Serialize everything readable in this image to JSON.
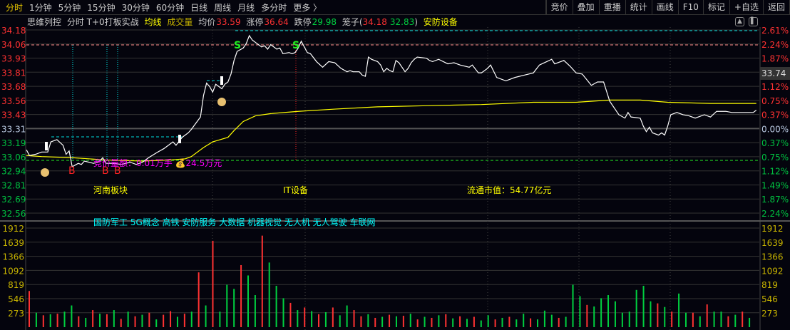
{
  "tabs": [
    "分时",
    "1分钟",
    "5分钟",
    "15分钟",
    "30分钟",
    "60分钟",
    "日线",
    "周线",
    "月线",
    "多分时",
    "更多 〉"
  ],
  "tools": [
    "竞价",
    "叠加",
    "重播",
    "统计",
    "画线",
    "F10",
    "标记",
    "+自选",
    "返回"
  ],
  "info": {
    "name": "思维列控",
    "mode": "分时 T+0打板实战",
    "avg_line": "均线",
    "volume": "成交量",
    "avg_label": "均价",
    "avg_value": "33.59",
    "limit_up_label": "涨停",
    "limit_up": "36.64",
    "limit_down_label": "跌停",
    "limit_down": "29.98",
    "cage_label": "笼子(",
    "cage_high": "34.18",
    "cage_low": "32.83",
    "cage_close": ")",
    "sector": "安防设备"
  },
  "annotations": {
    "auction": "竞价量额：0.01万手 ",
    "auction_amount": "24.5万元",
    "region": "河南板块",
    "industry": "IT设备",
    "market_cap": "流通市值：54.77亿元",
    "concepts": "国防军工 5G概念 高铁 安防服务 大数据 机器视觉 无人机 无人驾驶 车联网",
    "current_price": "33.74",
    "buy_mark": "B",
    "sell_mark": "S"
  },
  "colors": {
    "up": "#ff3232",
    "down": "#00d040",
    "price": "#ffffff",
    "avg": "#ffff00",
    "cyan": "#00e0e0"
  },
  "chart_data": {
    "type": "line",
    "price_axis": [
      "34.18",
      "34.06",
      "33.93",
      "33.81",
      "33.68",
      "33.56",
      "33.43",
      "33.31",
      "33.19",
      "33.06",
      "32.94",
      "32.81",
      "32.69",
      "32.56"
    ],
    "pct_axis": [
      "2.61%",
      "2.24%",
      "1.87%",
      "1.49%",
      "1.12%",
      "0.75%",
      "0.37%",
      "0.00%",
      "0.37%",
      "0.75%",
      "1.12%",
      "1.49%",
      "1.87%",
      "2.24%"
    ],
    "volume_axis": [
      "1912",
      "1639",
      "1366",
      "1092",
      "819",
      "546",
      "273"
    ],
    "ylim": [
      32.56,
      34.18
    ],
    "prev_close": 33.31,
    "price": [
      [
        0,
        33.12
      ],
      [
        1,
        33.07
      ],
      [
        3,
        33.08
      ],
      [
        5,
        33.1
      ],
      [
        7,
        33.1
      ],
      [
        8,
        33.19
      ],
      [
        10,
        33.21
      ],
      [
        12,
        33.16
      ],
      [
        13,
        33.08
      ],
      [
        14,
        33.11
      ],
      [
        15,
        32.97
      ],
      [
        17,
        33.0
      ],
      [
        18,
        32.99
      ],
      [
        19,
        33.02
      ],
      [
        22,
        33.0
      ],
      [
        24,
        33.02
      ],
      [
        25,
        33.05
      ],
      [
        26,
        33.0
      ],
      [
        29,
        33.0
      ],
      [
        31,
        32.99
      ],
      [
        34,
        33.01
      ],
      [
        36,
        32.99
      ],
      [
        38,
        33.01
      ],
      [
        40,
        33.05
      ],
      [
        43,
        33.1
      ],
      [
        45,
        33.13
      ],
      [
        47,
        33.17
      ],
      [
        48,
        33.19
      ],
      [
        49,
        33.16
      ],
      [
        51,
        33.23
      ],
      [
        53,
        33.27
      ],
      [
        54,
        33.3
      ],
      [
        57,
        33.41
      ],
      [
        58,
        33.6
      ],
      [
        59,
        33.71
      ],
      [
        60,
        33.68
      ],
      [
        61,
        33.63
      ],
      [
        62,
        33.7
      ],
      [
        64,
        33.66
      ],
      [
        65,
        33.7
      ],
      [
        66,
        33.72
      ],
      [
        67,
        33.79
      ],
      [
        68,
        33.91
      ],
      [
        69,
        33.99
      ],
      [
        71,
        34.02
      ],
      [
        72,
        34.06
      ],
      [
        73,
        34.13
      ],
      [
        74,
        34.09
      ],
      [
        75,
        34.07
      ],
      [
        77,
        34.03
      ],
      [
        78,
        34.04
      ],
      [
        79,
        34.01
      ],
      [
        80,
        34.05
      ],
      [
        82,
        34.01
      ],
      [
        83,
        34.02
      ],
      [
        84,
        33.97
      ],
      [
        86,
        33.98
      ],
      [
        87,
        33.97
      ],
      [
        88,
        33.98
      ],
      [
        89,
        34.02
      ],
      [
        90,
        34.08
      ],
      [
        92,
        33.98
      ],
      [
        93,
        33.97
      ],
      [
        95,
        33.9
      ],
      [
        97,
        33.85
      ],
      [
        99,
        33.9
      ],
      [
        101,
        33.89
      ],
      [
        103,
        33.84
      ],
      [
        105,
        33.81
      ],
      [
        106,
        33.82
      ],
      [
        107,
        33.81
      ],
      [
        109,
        33.81
      ],
      [
        110,
        33.78
      ],
      [
        111,
        33.77
      ],
      [
        112,
        33.94
      ],
      [
        113,
        33.92
      ],
      [
        115,
        33.9
      ],
      [
        116,
        33.87
      ],
      [
        117,
        33.81
      ],
      [
        118,
        33.84
      ],
      [
        119,
        33.82
      ],
      [
        120,
        33.81
      ],
      [
        121,
        33.91
      ],
      [
        122,
        33.89
      ],
      [
        124,
        33.81
      ],
      [
        125,
        33.84
      ],
      [
        126,
        33.89
      ],
      [
        127,
        33.92
      ],
      [
        128,
        33.94
      ],
      [
        131,
        33.93
      ],
      [
        132,
        33.91
      ],
      [
        133,
        33.9
      ],
      [
        135,
        33.92
      ],
      [
        138,
        33.88
      ],
      [
        140,
        33.89
      ],
      [
        142,
        33.87
      ],
      [
        145,
        33.85
      ],
      [
        146,
        33.87
      ],
      [
        148,
        33.8
      ],
      [
        149,
        33.8
      ],
      [
        151,
        33.84
      ],
      [
        152,
        33.87
      ],
      [
        154,
        33.76
      ],
      [
        157,
        33.73
      ],
      [
        160,
        33.76
      ],
      [
        163,
        33.78
      ],
      [
        166,
        33.8
      ],
      [
        168,
        33.87
      ],
      [
        172,
        33.92
      ],
      [
        173,
        33.88
      ],
      [
        176,
        33.91
      ],
      [
        178,
        33.86
      ],
      [
        180,
        33.8
      ],
      [
        182,
        33.79
      ],
      [
        185,
        33.69
      ],
      [
        187,
        33.72
      ],
      [
        189,
        33.72
      ],
      [
        191,
        33.55
      ],
      [
        194,
        33.43
      ],
      [
        196,
        33.4
      ],
      [
        197,
        33.45
      ],
      [
        198,
        33.41
      ],
      [
        201,
        33.4
      ],
      [
        202,
        33.33
      ],
      [
        203,
        33.28
      ],
      [
        204,
        33.32
      ],
      [
        205,
        33.27
      ],
      [
        207,
        33.25
      ],
      [
        208,
        33.27
      ],
      [
        209,
        33.25
      ],
      [
        210,
        33.33
      ],
      [
        211,
        33.43
      ],
      [
        213,
        33.45
      ],
      [
        215,
        33.43
      ],
      [
        217,
        33.42
      ],
      [
        219,
        33.4
      ],
      [
        222,
        33.43
      ],
      [
        224,
        33.41
      ],
      [
        226,
        33.46
      ],
      [
        229,
        33.46
      ],
      [
        231,
        33.45
      ],
      [
        233,
        33.45
      ],
      [
        236,
        33.45
      ],
      [
        238,
        33.45
      ],
      [
        239,
        33.47
      ]
    ],
    "avg": [
      [
        0,
        33.07
      ],
      [
        5,
        33.06
      ],
      [
        15,
        33.05
      ],
      [
        26,
        33.03
      ],
      [
        38,
        33.02
      ],
      [
        47,
        33.03
      ],
      [
        52,
        33.04
      ],
      [
        54,
        33.06
      ],
      [
        58,
        33.14
      ],
      [
        61,
        33.19
      ],
      [
        66,
        33.23
      ],
      [
        68,
        33.29
      ],
      [
        71,
        33.37
      ],
      [
        75,
        33.42
      ],
      [
        80,
        33.44
      ],
      [
        89,
        33.46
      ],
      [
        101,
        33.48
      ],
      [
        115,
        33.5
      ],
      [
        131,
        33.51
      ],
      [
        149,
        33.52
      ],
      [
        166,
        33.54
      ],
      [
        180,
        33.54
      ],
      [
        191,
        33.56
      ],
      [
        201,
        33.56
      ],
      [
        210,
        33.54
      ],
      [
        224,
        33.53
      ],
      [
        239,
        33.53
      ]
    ],
    "volume": [
      700,
      -280,
      230,
      -250,
      260,
      -300,
      -420,
      210,
      -180,
      330,
      -260,
      250,
      -330,
      160,
      -300,
      210,
      -240,
      280,
      -150,
      240,
      310,
      -200,
      260,
      -300,
      1060,
      -420,
      1670,
      -300,
      -820,
      -740,
      1200,
      -1000,
      -620,
      1770,
      -1250,
      -800,
      -560,
      470,
      -330,
      380,
      -310,
      250,
      -290,
      380,
      -230,
      -420,
      330,
      210,
      -250,
      180,
      -200,
      240,
      -210,
      220,
      -260,
      150,
      -200,
      180,
      -230,
      250,
      -170,
      210,
      -160,
      200,
      -130,
      -230,
      150,
      -180,
      200,
      -150,
      -260,
      170,
      -150,
      -320,
      -240,
      180,
      -200,
      -820,
      -600,
      430,
      -400,
      -560,
      -620,
      -500,
      -280,
      -300,
      -720,
      -800,
      -500,
      460,
      -390,
      300,
      -650,
      -280,
      280,
      -210,
      440,
      -300,
      -300,
      210,
      -240,
      300,
      -180
    ]
  }
}
